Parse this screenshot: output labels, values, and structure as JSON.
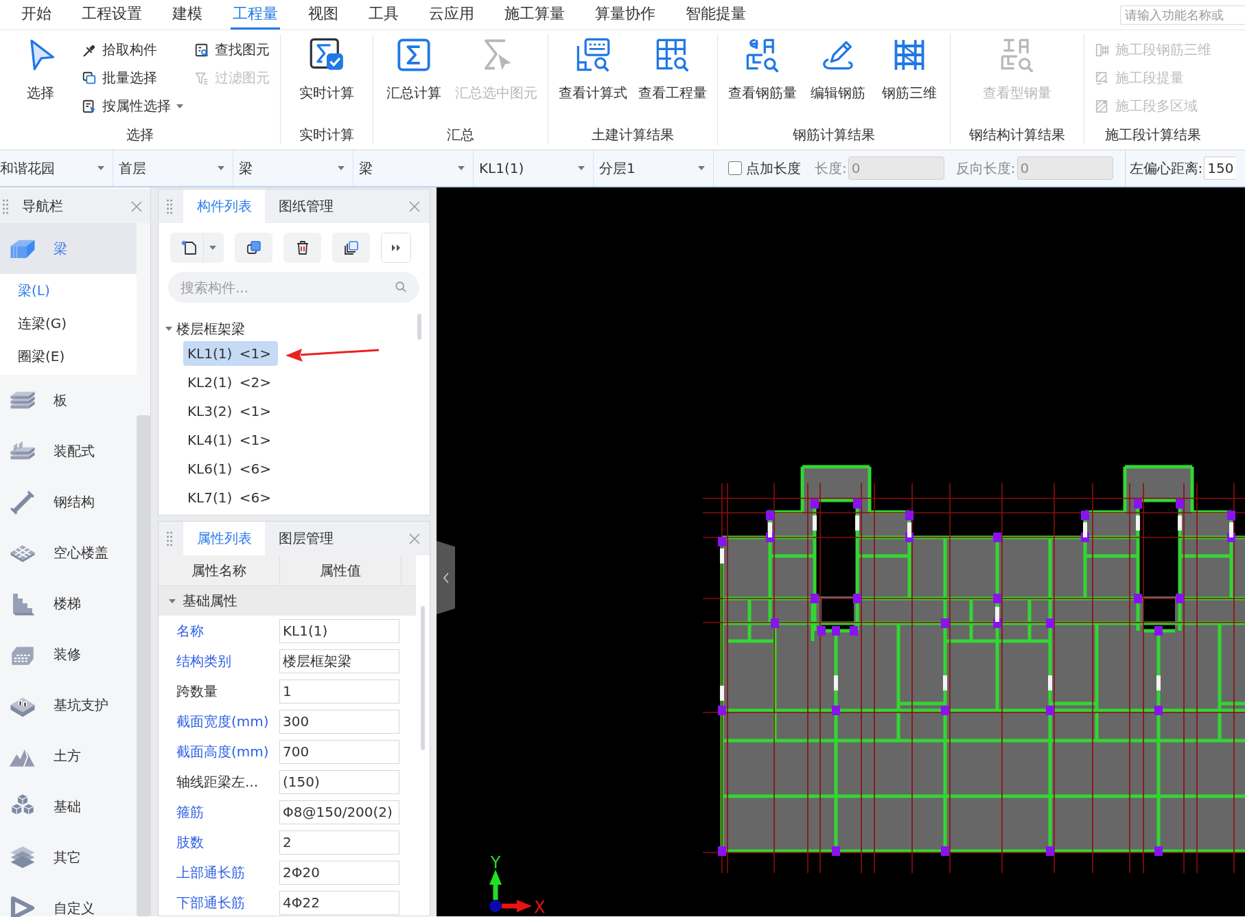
{
  "menu_tabs": [
    {
      "label": "开始",
      "selected": false
    },
    {
      "label": "工程设置",
      "selected": false
    },
    {
      "label": "建模",
      "selected": false
    },
    {
      "label": "工程量",
      "selected": true
    },
    {
      "label": "视图",
      "selected": false
    },
    {
      "label": "工具",
      "selected": false
    },
    {
      "label": "云应用",
      "selected": false
    },
    {
      "label": "施工算量",
      "selected": false
    },
    {
      "label": "算量协作",
      "selected": false
    },
    {
      "label": "智能提量",
      "selected": false
    }
  ],
  "function_search": {
    "placeholder": "请输入功能名称或"
  },
  "ribbon": [
    {
      "label": "选择",
      "buttons": [
        {
          "label": "选择",
          "kind": "large",
          "disabled": false,
          "dropdown": false
        },
        {
          "label": "拾取构件",
          "kind": "small",
          "disabled": false,
          "dropdown": false
        },
        {
          "label": "批量选择",
          "kind": "small",
          "disabled": false,
          "dropdown": false
        },
        {
          "label": "按属性选择",
          "kind": "small",
          "disabled": false,
          "dropdown": true
        },
        {
          "label": "查找图元",
          "kind": "small",
          "disabled": false,
          "dropdown": false
        },
        {
          "label": "过滤图元",
          "kind": "small",
          "disabled": true,
          "dropdown": false
        }
      ]
    },
    {
      "label": "实时计算",
      "buttons": [
        {
          "label": "实时计算",
          "kind": "large",
          "disabled": false,
          "dropdown": false
        }
      ]
    },
    {
      "label": "汇总",
      "buttons": [
        {
          "label": "汇总计算",
          "kind": "large",
          "disabled": false,
          "dropdown": false
        },
        {
          "label": "汇总选中图元",
          "kind": "large",
          "disabled": true,
          "dropdown": false
        }
      ]
    },
    {
      "label": "土建计算结果",
      "buttons": [
        {
          "label": "查看计算式",
          "kind": "large",
          "disabled": false,
          "dropdown": false
        },
        {
          "label": "查看工程量",
          "kind": "large",
          "disabled": false,
          "dropdown": false
        }
      ]
    },
    {
      "label": "钢筋计算结果",
      "buttons": [
        {
          "label": "查看钢筋量",
          "kind": "large",
          "disabled": false,
          "dropdown": false
        },
        {
          "label": "编辑钢筋",
          "kind": "large",
          "disabled": false,
          "dropdown": false
        },
        {
          "label": "钢筋三维",
          "kind": "large",
          "disabled": false,
          "dropdown": false
        }
      ]
    },
    {
      "label": "钢结构计算结果",
      "buttons": [
        {
          "label": "查看型钢量",
          "kind": "large",
          "disabled": true,
          "dropdown": false
        }
      ]
    },
    {
      "label": "施工段计算结果",
      "buttons": [
        {
          "label": "施工段钢筋三维",
          "kind": "small",
          "disabled": true,
          "dropdown": false
        },
        {
          "label": "施工段提量",
          "kind": "small",
          "disabled": true,
          "dropdown": false
        },
        {
          "label": "施工段多区域",
          "kind": "small",
          "disabled": true,
          "dropdown": false
        }
      ]
    }
  ],
  "toolbar": {
    "dropdowns": [
      {
        "value": "和谐花园"
      },
      {
        "value": "首层"
      },
      {
        "value": "梁"
      },
      {
        "value": "梁"
      },
      {
        "value": "KL1(1)"
      },
      {
        "value": "分层1"
      }
    ],
    "checkbox": {
      "label": "点加长度",
      "checked": false
    },
    "fields": [
      {
        "label": "长度:",
        "value": "0",
        "disabled": true
      },
      {
        "label": "反向长度:",
        "value": "0",
        "disabled": true
      }
    ],
    "offset_field": {
      "label": "左偏心距离:",
      "value": "150",
      "disabled": false
    }
  },
  "navigation": {
    "title": "导航栏",
    "items": [
      {
        "label": "梁",
        "selected": true,
        "children": [
          {
            "label": "梁(L)",
            "selected": true
          },
          {
            "label": "连梁(G)",
            "selected": false
          },
          {
            "label": "圈梁(E)",
            "selected": false
          }
        ]
      },
      {
        "label": "板",
        "selected": false
      },
      {
        "label": "装配式",
        "selected": false
      },
      {
        "label": "钢结构",
        "selected": false
      },
      {
        "label": "空心楼盖",
        "selected": false
      },
      {
        "label": "楼梯",
        "selected": false
      },
      {
        "label": "装修",
        "selected": false
      },
      {
        "label": "基坑支护",
        "selected": false
      },
      {
        "label": "土方",
        "selected": false
      },
      {
        "label": "基础",
        "selected": false
      },
      {
        "label": "其它",
        "selected": false
      },
      {
        "label": "自定义",
        "selected": false
      }
    ]
  },
  "component_panel": {
    "tabs": [
      {
        "label": "构件列表",
        "selected": true
      },
      {
        "label": "图纸管理",
        "selected": false
      }
    ],
    "search": {
      "placeholder": "搜索构件..."
    },
    "tree": [
      {
        "label": "楼层框架梁",
        "expanded": true,
        "children": [
          {
            "label": "KL1(1) <1>",
            "selected": true
          },
          {
            "label": "KL2(1) <2>",
            "selected": false
          },
          {
            "label": "KL3(2) <1>",
            "selected": false
          },
          {
            "label": "KL4(1) <1>",
            "selected": false
          },
          {
            "label": "KL6(1) <6>",
            "selected": false
          },
          {
            "label": "KL7(1) <6>",
            "selected": false
          }
        ]
      }
    ]
  },
  "property_panel": {
    "tabs": [
      {
        "label": "属性列表",
        "selected": true
      },
      {
        "label": "图层管理",
        "selected": false
      }
    ],
    "columns": [
      "属性名称",
      "属性值"
    ],
    "group": {
      "label": "基础属性",
      "expanded": true
    },
    "rows": [
      {
        "name": "名称",
        "value": "KL1(1)",
        "public": true
      },
      {
        "name": "结构类别",
        "value": "楼层框架梁",
        "public": true
      },
      {
        "name": "跨数量",
        "value": "1",
        "public": false
      },
      {
        "name": "截面宽度(mm)",
        "value": "300",
        "public": true
      },
      {
        "name": "截面高度(mm)",
        "value": "700",
        "public": true
      },
      {
        "name": "轴线距梁左...",
        "value": "(150)",
        "public": false
      },
      {
        "name": "箍筋",
        "value": "Φ8@150/200(2)",
        "public": true
      },
      {
        "name": "肢数",
        "value": "2",
        "public": true
      },
      {
        "name": "上部通长筋",
        "value": "2Φ20",
        "public": true
      },
      {
        "name": "下部通长筋",
        "value": "4Φ22",
        "public": true
      }
    ]
  },
  "canvas": {
    "x_label": "X",
    "y_label": "Y"
  }
}
